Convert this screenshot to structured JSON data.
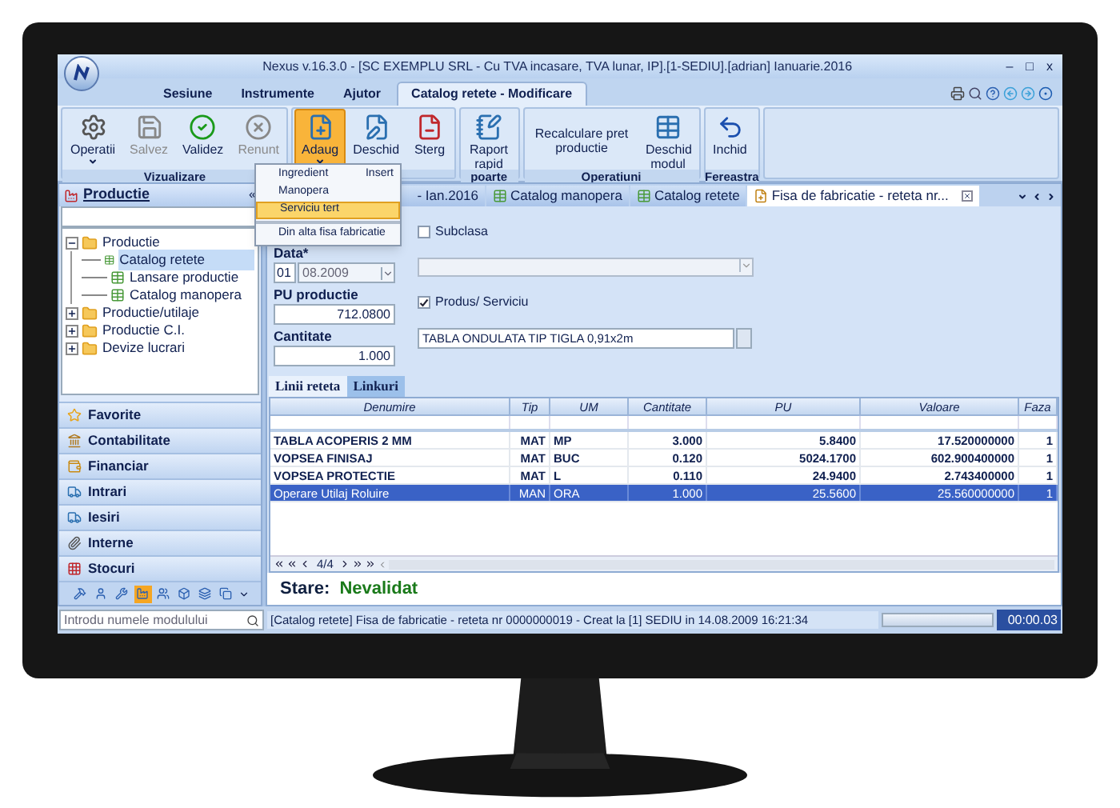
{
  "window": {
    "title": "Nexus v.16.3.0 - [SC EXEMPLU SRL - Cu TVA incasare, TVA lunar, IP].[1-SEDIU].[adrian] Ianuarie.2016",
    "controls": [
      "–",
      "□",
      "x"
    ]
  },
  "menu": [
    {
      "label": "Sesiune",
      "selected": false
    },
    {
      "label": "Instrumente",
      "selected": false
    },
    {
      "label": "Ajutor",
      "selected": false
    },
    {
      "label": "Catalog retete -  Modificare",
      "selected": true
    }
  ],
  "ribbon": [
    {
      "label": "Vizualizare",
      "buttons": [
        {
          "label": "Operatii",
          "dropdown": true,
          "disabled": false,
          "selected": false
        },
        {
          "label": "Salvez",
          "dropdown": false,
          "disabled": true,
          "selected": false
        },
        {
          "label": "Validez",
          "dropdown": false,
          "disabled": false,
          "selected": false
        },
        {
          "label": "Renunt",
          "dropdown": false,
          "disabled": true,
          "selected": false
        }
      ]
    },
    {
      "buttons": [
        {
          "label": "Adaug",
          "dropdown": true,
          "disabled": false,
          "selected": true
        },
        {
          "label": "Deschid",
          "dropdown": false,
          "disabled": false,
          "selected": false
        },
        {
          "label": "Sterg",
          "dropdown": false,
          "disabled": false,
          "selected": false
        }
      ]
    },
    {
      "label": "poarte",
      "buttons": [
        {
          "label": "Raport rapid",
          "dropdown": false,
          "disabled": false,
          "selected": false
        }
      ]
    },
    {
      "label": "Operatiuni",
      "buttons": [
        {
          "label": "Recalculare pret productie",
          "dropdown": false,
          "disabled": false,
          "selected": false
        },
        {
          "label": "Deschid modul",
          "dropdown": false,
          "disabled": false,
          "selected": false
        }
      ]
    },
    {
      "label": "Fereastra",
      "buttons": [
        {
          "label": "Inchid",
          "dropdown": false,
          "disabled": false,
          "selected": false
        }
      ]
    }
  ],
  "dropdown_menu": [
    {
      "label": "Ingredient",
      "shortcut": "Insert",
      "selected": false,
      "separator_before": false
    },
    {
      "label": "Manopera",
      "selected": false,
      "separator_before": false
    },
    {
      "label": "Serviciu tert",
      "selected": true,
      "separator_before": false
    },
    {
      "label": "Din alta fisa fabricatie",
      "selected": false,
      "separator_before": true
    }
  ],
  "sidebar": {
    "title": "Productie",
    "collapse": "«",
    "tree": [
      {
        "label": "Productie",
        "expanded": true,
        "selected": false,
        "children": [
          {
            "label": "Catalog retete",
            "selected": true
          },
          {
            "label": "Lansare productie",
            "selected": false
          },
          {
            "label": "Catalog manopera",
            "selected": false
          }
        ]
      },
      {
        "label": "Productie/utilaje",
        "expanded": false,
        "selected": false
      },
      {
        "label": "Productie C.I.",
        "expanded": false,
        "selected": false
      },
      {
        "label": "Devize lucrari",
        "expanded": false,
        "selected": false
      }
    ],
    "sections": [
      {
        "label": "Favorite"
      },
      {
        "label": "Contabilitate"
      },
      {
        "label": "Financiar"
      },
      {
        "label": "Intrari"
      },
      {
        "label": "Iesiri"
      },
      {
        "label": "Interne"
      },
      {
        "label": "Stocuri"
      }
    ],
    "shortcuts": [
      {
        "selected": false
      },
      {
        "selected": false
      },
      {
        "selected": false
      },
      {
        "selected": true
      },
      {
        "selected": false
      },
      {
        "selected": false
      },
      {
        "selected": false
      },
      {
        "selected": false
      }
    ]
  },
  "tabs": [
    {
      "label": "- Ian.2016",
      "selected": false,
      "closable": false
    },
    {
      "label": "Catalog manopera",
      "selected": false,
      "closable": false
    },
    {
      "label": "Catalog retete",
      "selected": false,
      "closable": false
    },
    {
      "label": "Fisa de fabricatie - reteta nr...",
      "selected": true,
      "closable": true
    }
  ],
  "form": {
    "date_label": "Data*",
    "day": "01",
    "date": "08.2009",
    "pu_label": "PU productie",
    "pu": "712.0800",
    "qty_label": "Cantitate",
    "qty": "1.000",
    "subclasa": {
      "label": "Subclasa",
      "checked": false
    },
    "produs": {
      "label": "Produs/ Serviciu",
      "checked": true
    },
    "product": "TABLA ONDULATA TIP TIGLA 0,91x2m"
  },
  "subtabs": [
    {
      "label": "Linii reteta",
      "selected": true
    },
    {
      "label": "Linkuri",
      "selected": false
    }
  ],
  "table": {
    "columns": [
      "Denumire",
      "Tip",
      "UM",
      "Cantitate",
      "PU",
      "Valoare",
      "Faza"
    ],
    "rows": [
      {
        "cells": [
          "TABLA ACOPERIS 2 MM",
          "MAT",
          "MP",
          "3.000",
          "5.8400",
          "17.520000000",
          "1"
        ],
        "selected": false
      },
      {
        "cells": [
          "VOPSEA FINISAJ",
          "MAT",
          "BUC",
          "0.120",
          "5024.1700",
          "602.900400000",
          "1"
        ],
        "selected": false
      },
      {
        "cells": [
          "VOPSEA PROTECTIE",
          "MAT",
          "L",
          "0.110",
          "24.9400",
          "2.743400000",
          "1"
        ],
        "selected": false
      },
      {
        "cells": [
          "Operare Utilaj Roluire",
          "MAN",
          "ORA",
          "1.000",
          "25.5600",
          "25.560000000",
          "1"
        ],
        "selected": true
      }
    ],
    "pager": "4/4"
  },
  "status": {
    "label": "Stare:",
    "value": "Nevalidat"
  },
  "status_bar": {
    "placeholder": "Introdu numele modulului",
    "message": "[Catalog retete] Fisa de fabricatie - reteta nr 0000000019 - Creat la [1] SEDIU  in 14.08.2009 16:21:34",
    "time": "00:00.03",
    "progress": {
      "level": 0
    }
  }
}
